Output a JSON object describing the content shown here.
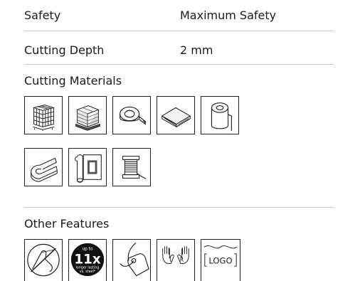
{
  "specs": {
    "safety_label": "Safety",
    "safety_value": "Maximum Safety",
    "depth_label": "Cutting Depth",
    "depth_value": "2 mm"
  },
  "materials": {
    "title": "Cutting Materials",
    "icons": [
      "pallet-stretch-wrap-icon",
      "wrapped-pallet-icon",
      "tape-roll-icon",
      "cardboard-sheet-icon",
      "film-roll-icon",
      "folded-sheet-icon",
      "carpet-roll-icon",
      "thread-spool-icon"
    ]
  },
  "features": {
    "title": "Other Features",
    "badge_top": "up to",
    "badge_number": "11x",
    "badge_bottom_1": "longer lasting",
    "badge_bottom_2": "vs. steel*",
    "hand_left": "L",
    "hand_right": "R",
    "logo_text": "LOGO",
    "icons": [
      "finger-guard-icon",
      "longer-lasting-badge-icon",
      "hanging-tag-icon",
      "left-right-hand-icon",
      "logo-imprint-icon"
    ]
  },
  "colors": {
    "text": "#1a1a1a",
    "rule": "#c8c8c8",
    "icon_stroke": "#222222"
  }
}
